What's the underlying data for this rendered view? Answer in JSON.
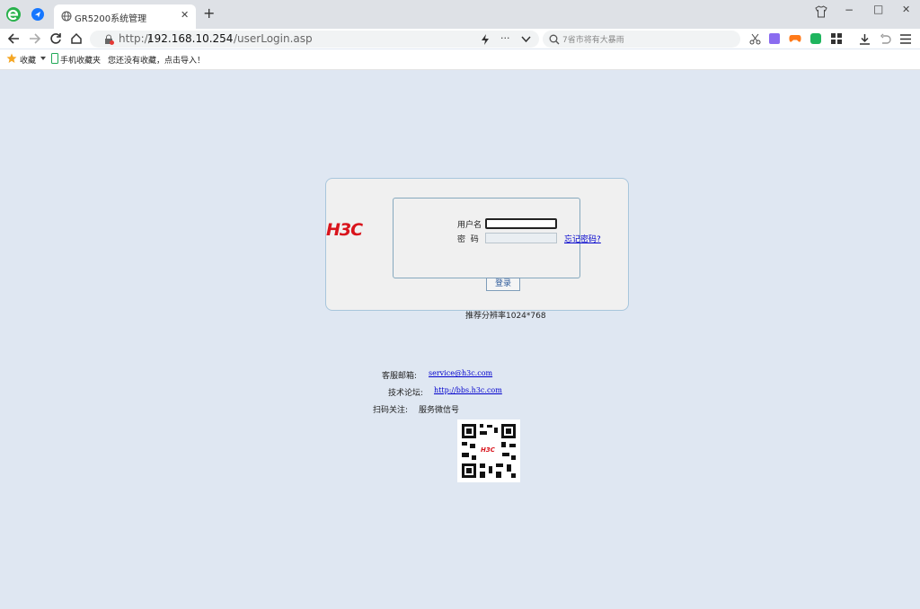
{
  "browser": {
    "tab_title": "GR5200系统管理",
    "new_tab_symbol": "+",
    "url_prefix": "http://",
    "url_host": "192.168.10.254",
    "url_path": "/userLogin.asp",
    "search_placeholder": "7省市将有大暴雨",
    "more_symbol": "···",
    "window_minimize": "−",
    "window_maximize": "□",
    "window_close": "✕"
  },
  "bookmarks": {
    "favorites_label": "收藏",
    "mobile_label": "手机收藏夹",
    "empty_hint": "您还没有收藏，点击导入！"
  },
  "login": {
    "logo_text": "H3C",
    "username_label": "用户名",
    "password_label": "密  码",
    "forgot_password": "忘记密码?",
    "login_button": "登录",
    "resolution_hint": "推荐分辨率1024*768"
  },
  "support": {
    "email_label": "客服邮箱:",
    "email_value": "service@h3c.com",
    "forum_label": "技术论坛:",
    "forum_value": "http://bbs.h3c.com",
    "qr_label": "扫码关注:",
    "qr_value": "服务微信号",
    "qr_logo": "H3C"
  }
}
